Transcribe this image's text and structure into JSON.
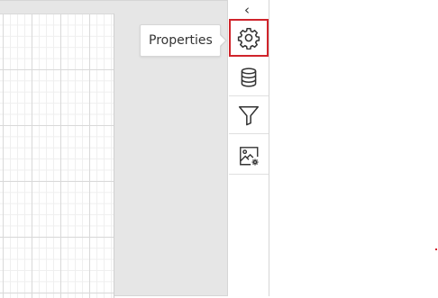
{
  "tooltip": {
    "text": "Properties"
  },
  "panel": {
    "collapse_glyph": "‹",
    "tools": [
      {
        "name": "properties",
        "icon": "gear-icon",
        "active": true
      },
      {
        "name": "data",
        "icon": "database-icon",
        "active": false
      },
      {
        "name": "filter",
        "icon": "funnel-icon",
        "active": false
      },
      {
        "name": "image-settings",
        "icon": "image-settings-icon",
        "active": false
      }
    ]
  },
  "colors": {
    "accent": "#d0242b",
    "designer_background": "#e6e6e6",
    "icon": "#333333"
  }
}
